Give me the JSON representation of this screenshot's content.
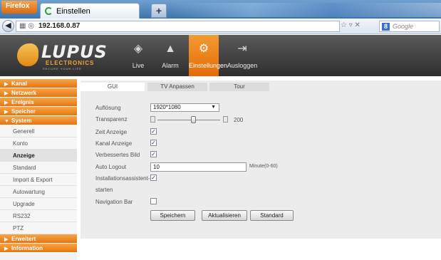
{
  "browser": {
    "firefox_label": "Firefox",
    "tab_title": "Einstellen",
    "newtab_label": "+",
    "url": "192.168.0.87",
    "url_controls": "☆ ▿ ✕",
    "search_placeholder": "Google"
  },
  "app": {
    "logo": {
      "name": "LUPUS",
      "sub": "ELECTRONICS",
      "tagline": "SECURE YOUR LIFE"
    },
    "nav": [
      {
        "label": "Live",
        "icon": "camera-icon"
      },
      {
        "label": "Alarm",
        "icon": "bell-icon"
      },
      {
        "label": "Einstellungen",
        "icon": "gear-icon",
        "active": true
      },
      {
        "label": "Ausloggen",
        "icon": "logout-icon"
      }
    ]
  },
  "sidebar": {
    "categories": [
      "Kanal",
      "Netzwerk",
      "Ereignis",
      "Speicher",
      "System",
      "Erweitert",
      "Information"
    ],
    "system_items": [
      "Generell",
      "Konto",
      "Anzeige",
      "Standard",
      "Import & Export",
      "Autowartung",
      "Upgrade",
      "RS232",
      "PTZ"
    ],
    "active_item": "Anzeige"
  },
  "tabs": [
    "GUI",
    "TV Anpassen",
    "Tour"
  ],
  "form": {
    "aufloesung_label": "Auflösung",
    "aufloesung_value": "1920*1080",
    "transparenz_label": "Transparenz",
    "transparenz_value": "200",
    "zeit_label": "Zeit Anzeige",
    "kanal_label": "Kanal Anzeige",
    "bild_label": "Verbessertes Bild",
    "logout_label": "Auto Logout",
    "logout_value": "10",
    "logout_unit": "Minute(0-60)",
    "install_label_1": "Installationsassistent-",
    "install_label_2": "starten",
    "navbar_label": "Navigation Bar",
    "check_mark": "✓"
  },
  "buttons": {
    "save": "Speichern",
    "refresh": "Aktualisieren",
    "default": "Standard"
  }
}
